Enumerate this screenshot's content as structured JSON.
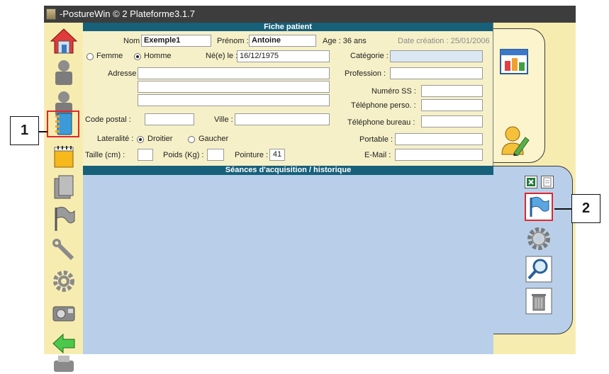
{
  "window": {
    "title": "-PostureWin © 2 Plateforme3.1.7"
  },
  "form": {
    "header": "Fiche patient",
    "nom_label": "Nom :",
    "nom_value": "Exemple1",
    "prenom_label": "Prénom :",
    "prenom_value": "Antoine",
    "age": "Age : 36 ans",
    "date_creation": "Date création : 25/01/2006",
    "femme_label": "Femme",
    "homme_label": "Homme",
    "sexe_selected": "Homme",
    "ne_le_label": "Né(e) le :",
    "ne_le_value": "16/12/1975",
    "categorie_label": "Catégorie :",
    "categorie_value": "",
    "adresse_label": "Adresse :",
    "adresse_line1": "",
    "adresse_line2": "",
    "adresse_line3": "",
    "profession_label": "Profession :",
    "profession_value": "",
    "numero_ss_label": "Numéro SS :",
    "numero_ss_value": "",
    "tel_perso_label": "Téléphone perso. :",
    "tel_perso_value": "",
    "code_postal_label": "Code postal :",
    "code_postal_value": "",
    "ville_label": "Ville :",
    "ville_value": "",
    "tel_bureau_label": "Téléphone bureau :",
    "tel_bureau_value": "",
    "lateralite_label": "Lateralité :",
    "droitier_label": "Droitier",
    "gaucher_label": "Gaucher",
    "lateralite_selected": "Droitier",
    "portable_label": "Portable :",
    "portable_value": "",
    "taille_label": "Taille (cm) :",
    "taille_value": "",
    "poids_label": "Poids (Kg) :",
    "poids_value": "",
    "pointure_label": "Pointure :",
    "pointure_value": "41",
    "email_label": "E-Mail :",
    "email_value": ""
  },
  "sessions": {
    "header": "Séances d'acquisition / historique"
  },
  "left_toolbar": {
    "icons": [
      "home-icon",
      "user-icon",
      "user-icon",
      "notebook-icon",
      "notepad-icon",
      "document-icon",
      "flag-icon",
      "tools-icon",
      "gear-icon",
      "camera-icon",
      "back-arrow-icon",
      "printer-icon"
    ]
  },
  "right_toolbar": {
    "icons": [
      "window-icon",
      "edit-user-icon",
      "excel-icon",
      "page-icon",
      "flag-icon",
      "settings-icon",
      "search-icon",
      "trash-icon"
    ]
  },
  "callouts": {
    "one": "1",
    "two": "2"
  },
  "colors": {
    "header_bar": "#17607a",
    "panel_bg": "#f6f0c8",
    "sessions_bg": "#b9cfe9",
    "highlight": "#e0262e"
  }
}
